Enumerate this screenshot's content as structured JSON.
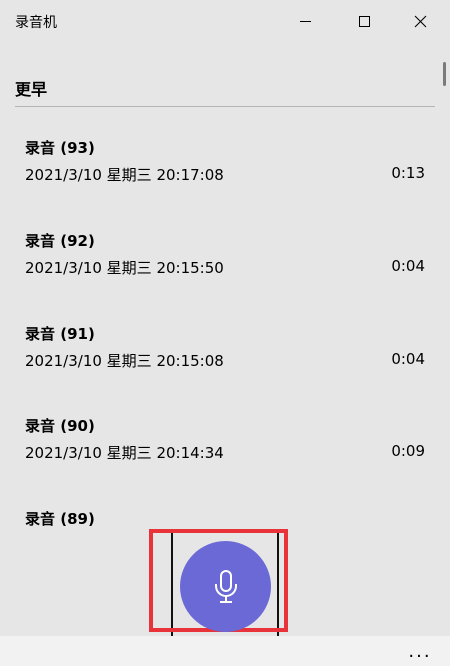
{
  "window": {
    "title": "录音机",
    "minimize_icon": "minimize-icon",
    "maximize_icon": "maximize-icon",
    "close_icon": "close-icon"
  },
  "section": {
    "title": "更早"
  },
  "recordings": [
    {
      "title": "录音 (93)",
      "datetime": "2021/3/10 星期三  20:17:08",
      "duration": "0:13"
    },
    {
      "title": "录音 (92)",
      "datetime": "2021/3/10 星期三  20:15:50",
      "duration": "0:04"
    },
    {
      "title": "录音 (91)",
      "datetime": "2021/3/10 星期三  20:15:08",
      "duration": "0:04"
    },
    {
      "title": "录音 (90)",
      "datetime": "2021/3/10 星期三  20:14:34",
      "duration": "0:09"
    },
    {
      "title": "录音 (89)",
      "datetime": "",
      "duration": ""
    }
  ],
  "record_button": {
    "icon": "microphone-icon",
    "color": "#6b69d6"
  },
  "bottom_bar": {
    "more_label": "..."
  },
  "colors": {
    "background": "#e6e6e6",
    "accent": "#6b69d6",
    "highlight": "#e8333a"
  }
}
